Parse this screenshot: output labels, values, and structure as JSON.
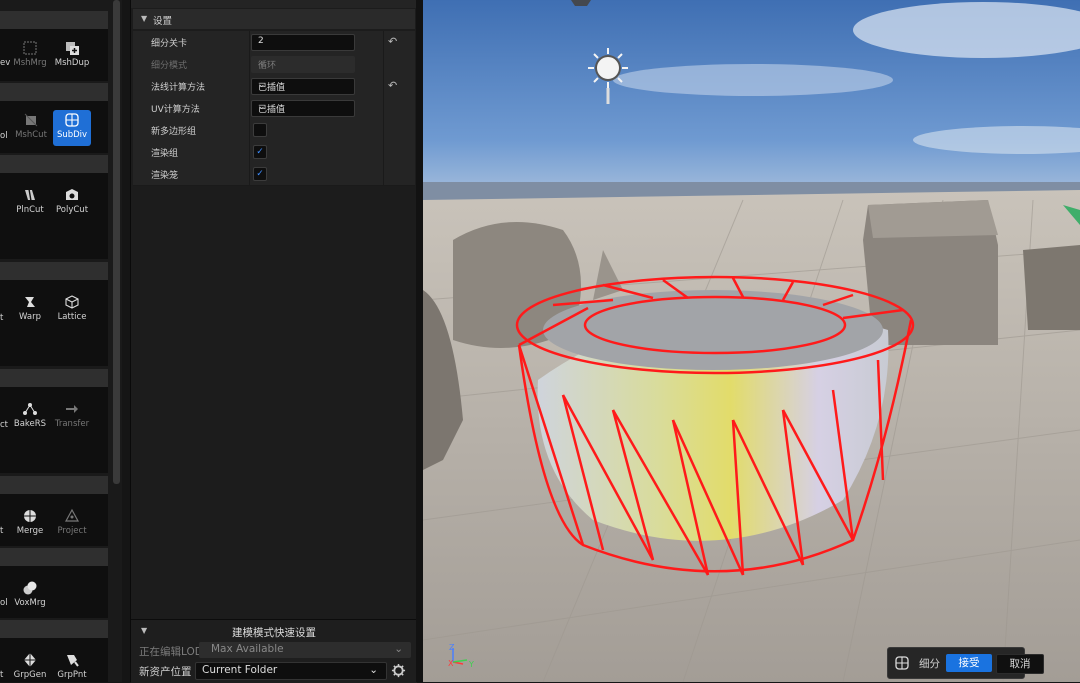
{
  "palette": {
    "groups": [
      {
        "tools": [
          {
            "label": "ev",
            "icon": "partial-tool-icon"
          },
          {
            "label": "MshMrg",
            "icon": "mesh-merge-icon"
          },
          {
            "label": "MshDup",
            "icon": "mesh-duplicate-icon"
          }
        ]
      },
      {
        "tools": [
          {
            "label": "ol",
            "icon": "partial-tool-icon"
          },
          {
            "label": "MshCut",
            "icon": "mesh-cut-icon"
          },
          {
            "label": "SubDiv",
            "icon": "subdivide-icon"
          }
        ]
      },
      {
        "tools": [
          {
            "label": "PlnCut",
            "icon": "plane-cut-icon"
          },
          {
            "label": "PolyCut",
            "icon": "poly-cut-icon"
          }
        ]
      },
      {
        "tools": [
          {
            "label": "t",
            "icon": "partial-tool-icon"
          },
          {
            "label": "Warp",
            "icon": "warp-icon"
          },
          {
            "label": "Lattice",
            "icon": "lattice-icon"
          }
        ]
      },
      {
        "tools": [
          {
            "label": "ct",
            "icon": "partial-tool-icon"
          },
          {
            "label": "BakeRS",
            "icon": "bake-rs-icon"
          },
          {
            "label": "Transfer",
            "icon": "transfer-icon"
          }
        ]
      },
      {
        "tools": [
          {
            "label": "t",
            "icon": "partial-tool-icon"
          },
          {
            "label": "Merge",
            "icon": "merge-icon"
          },
          {
            "label": "Project",
            "icon": "project-icon"
          }
        ]
      },
      {
        "tools": [
          {
            "label": "ol",
            "icon": "partial-tool-icon"
          },
          {
            "label": "VoxMrg",
            "icon": "voxel-merge-icon"
          }
        ]
      },
      {
        "tools": [
          {
            "label": "t",
            "icon": "partial-tool-icon"
          },
          {
            "label": "GrpGen",
            "icon": "group-generate-icon"
          },
          {
            "label": "GrpPnt",
            "icon": "group-paint-icon"
          }
        ]
      }
    ],
    "selected_tool": "SubDiv"
  },
  "details": {
    "section_title": "设置",
    "rows": {
      "subdiv_level": {
        "label": "细分关卡",
        "value": "2"
      },
      "subdiv_mode": {
        "label": "细分模式",
        "value": "循环"
      },
      "normal_method": {
        "label": "法线计算方法",
        "value": "已插值"
      },
      "uv_method": {
        "label": "UV计算方法",
        "value": "已插值"
      },
      "new_polygroups": {
        "label": "新多边形组",
        "checked": false
      },
      "render_groups": {
        "label": "渲染组",
        "checked": true
      },
      "render_cage": {
        "label": "渲染笼",
        "checked": true
      }
    },
    "checkmark": "✓",
    "reset_glyph": "↶",
    "dropdown_glyph": "⌄"
  },
  "quick_settings": {
    "title": "建模模式快速设置",
    "lod_label": "正在编辑LOD",
    "lod_value": "Max Available",
    "asset_location_label": "新资产位置",
    "asset_location_value": "Current Folder"
  },
  "accept_bar": {
    "tool_name": "细分",
    "accept_label": "接受",
    "cancel_label": "取消"
  },
  "gizmo_axes": {
    "z": "Z",
    "x": "X",
    "y": "Y"
  },
  "colors": {
    "accent": "#1a73e0",
    "cage_wire": "#ff1a1a",
    "sky_top": "#3f6fb3",
    "floor": "#b8b2aa"
  }
}
